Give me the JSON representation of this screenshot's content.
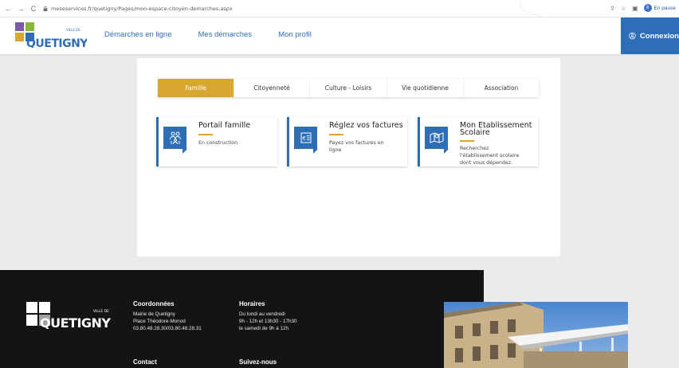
{
  "browser": {
    "url": "meseservices.fr/quetigny/Pages/mon-espace-citoyen-demarches.aspx",
    "profile_initial": "8",
    "profile_label": "En pause"
  },
  "header": {
    "logo_top_text": "VILLE DE",
    "logo_text": "QUETIGNY",
    "nav": [
      "Démarches en ligne",
      "Mes démarches",
      "Mon profil"
    ],
    "login_label": "Connexion"
  },
  "tabs": [
    {
      "label": "Famille",
      "active": true
    },
    {
      "label": "Citoyenneté",
      "active": false
    },
    {
      "label": "Culture - Loisirs",
      "active": false
    },
    {
      "label": "Vie quotidienne",
      "active": false
    },
    {
      "label": "Association",
      "active": false
    }
  ],
  "tiles": [
    {
      "title": "Portail famille",
      "desc": [
        "En construction"
      ],
      "icon": "family-icon"
    },
    {
      "title": "Réglez vos factures",
      "desc": [
        "Payez vos factures en",
        "ligne"
      ],
      "icon": "invoice-icon"
    },
    {
      "title": [
        "Mon Etablissement",
        "Scolaire"
      ],
      "desc": [
        "Recherchez",
        "l'établissement scolaire",
        "dont vous dépendez."
      ],
      "icon": "school-map-icon"
    }
  ],
  "footer": {
    "logo_top_text": "VILLE DE",
    "logo_text": "QUETIGNY",
    "coordonnees": {
      "heading": "Coordonnées",
      "lines": [
        "Mairie de Quetigny",
        "Place Théodore-Monod",
        "03.80.48.28.30/03.80.48.28.31"
      ]
    },
    "horaires": {
      "heading": "Horaires",
      "lines": [
        "Du lundi au vendredi",
        "9h - 12h et 13h30 - 17h30",
        "le samedi de 9h à 12h"
      ]
    },
    "contact_heading": "Contact",
    "social_heading": "Suivez-nous"
  },
  "colors": {
    "accent": "#d8a732",
    "brand_blue": "#2e6eb6",
    "footer_bg": "#141417"
  }
}
